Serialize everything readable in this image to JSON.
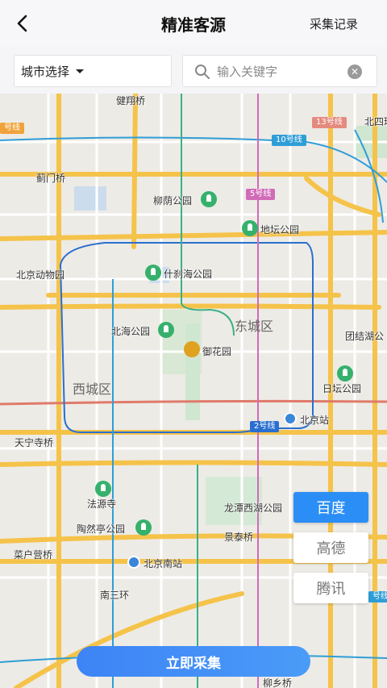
{
  "header": {
    "title": "精准客源",
    "records_label": "采集记录"
  },
  "filter": {
    "city_label": "城市选择",
    "search_placeholder": "输入关键字"
  },
  "map": {
    "labels": {
      "jianxiang_bridge": "健翔桥",
      "jimen_bridge": "蓟门桥",
      "liuyin_park": "柳荫公园",
      "ditan_park": "地坛公园",
      "beijing_zoo": "北京动物园",
      "shichahai_park": "什刹海公园",
      "beihai_park": "北海公园",
      "imperial_garden": "御花园",
      "tuanjiehu_park": "团结湖公",
      "ritan_park": "日坛公园",
      "beijing_station": "北京站",
      "tianningsi_bridge": "天宁寺桥",
      "fayuan_temple": "法源寺",
      "taoranting_park": "陶然亭公园",
      "longtan_park": "龙潭西湖公园",
      "jingtai_bridge": "景泰桥",
      "caihuying_bridge": "菜户营桥",
      "beijing_south_station": "北京南站",
      "south_3rd_ring": "南三环",
      "north_4th_ring": "北四环",
      "liuxiang_bridge": "柳乡桥"
    },
    "districts": {
      "dongcheng": "东城区",
      "xicheng": "西城区"
    },
    "lines": {
      "line10": "10号线",
      "line13": "13号线",
      "line5": "5号线",
      "line2": "2号线",
      "line_left_top": "号线",
      "line_right_bottom": "号线"
    },
    "providers": [
      {
        "label": "百度",
        "active": true
      },
      {
        "label": "高德",
        "active": false
      },
      {
        "label": "腾讯",
        "active": false
      }
    ]
  },
  "action": {
    "collect_label": "立即采集"
  },
  "colors": {
    "accent": "#2b8ef6",
    "park": "#35b16b",
    "subway_blue": "#3a86d9",
    "road_yellow": "#f5c34a"
  }
}
